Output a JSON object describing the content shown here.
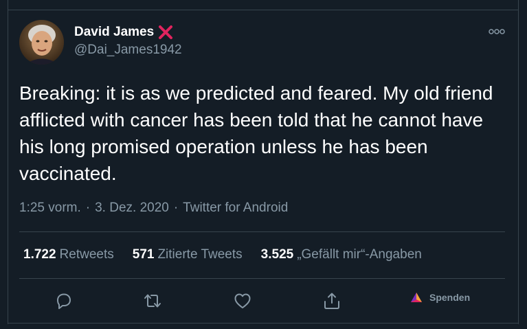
{
  "tweet": {
    "author": {
      "display_name": "David James",
      "handle": "@Dai_James1942",
      "avatar_icon": "avatar-photo"
    },
    "text": "Breaking: it is as we predicted and feared. My old friend afflicted with cancer has been told that he cannot have his long promised operation unless he has been vaccinated.",
    "meta": {
      "time": "1:25 vorm.",
      "separator": "·",
      "date": "3. Dez. 2020",
      "source": "Twitter for Android"
    },
    "stats": [
      {
        "count": "1.722",
        "label": "Retweets"
      },
      {
        "count": "571",
        "label": "Zitierte Tweets"
      },
      {
        "count": "3.525",
        "label": "„Gefällt mir“-Angaben"
      }
    ],
    "actions": {
      "donate_label": "Spenden"
    }
  },
  "colors": {
    "background": "#141d26",
    "border": "#38444d",
    "primary_text": "#ffffff",
    "secondary_text": "#8899a6",
    "x_mark": "#e0245e",
    "donate_triangle": "#e0245e"
  }
}
